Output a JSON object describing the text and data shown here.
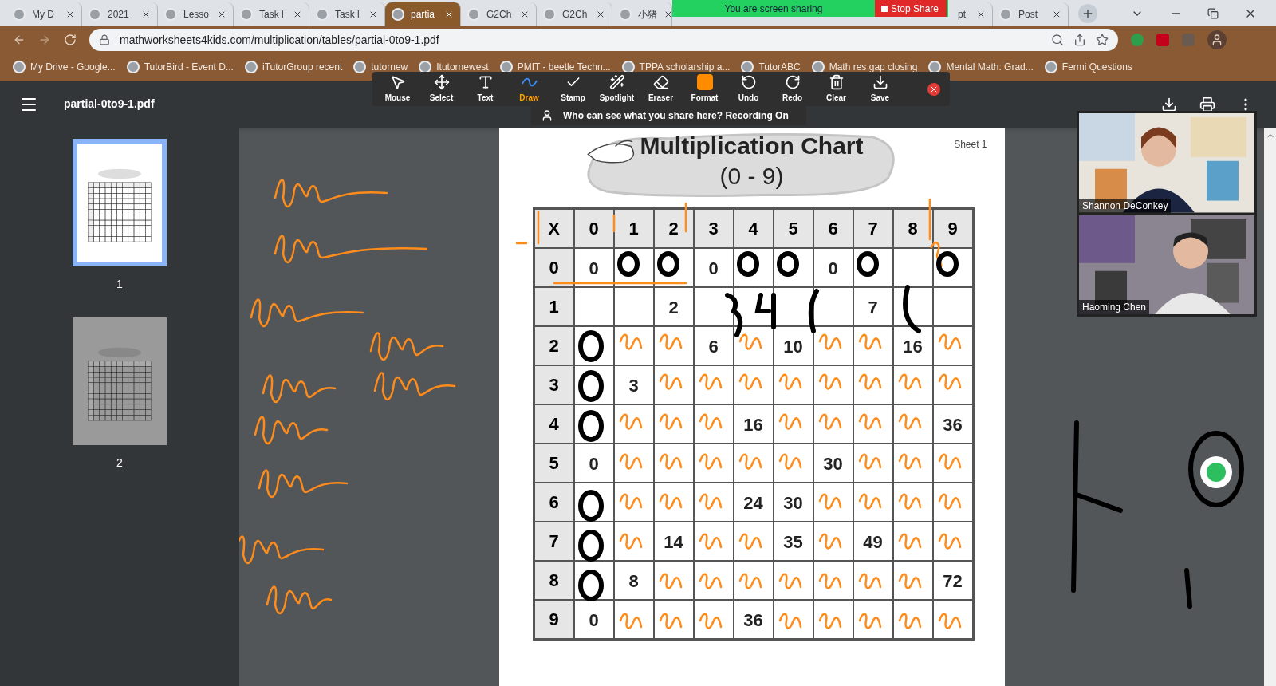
{
  "browser": {
    "tabs": [
      {
        "label": "My D",
        "selected": false
      },
      {
        "label": "2021",
        "selected": false
      },
      {
        "label": "Lesso",
        "selected": false
      },
      {
        "label": "Task l",
        "selected": false
      },
      {
        "label": "Task l",
        "selected": false
      },
      {
        "label": "partia",
        "selected": true
      },
      {
        "label": "G2Ch",
        "selected": false
      },
      {
        "label": "G2Ch",
        "selected": false
      },
      {
        "label": "小猪",
        "selected": false
      },
      {
        "label": "pt",
        "selected": false
      },
      {
        "label": "Post",
        "selected": false
      }
    ],
    "address": "mathworksheets4kids.com/multiplication/tables/partial-0to9-1.pdf",
    "bookmarks": [
      "My Drive - Google...",
      "TutorBird - Event D...",
      "iTutorGroup recent",
      "tutornew",
      "Itutornewest",
      "PMIT - beetle Techn...",
      "TPPA scholarship a...",
      "TutorABC",
      "Math res gap closing",
      "Mental Math: Grad...",
      "Fermi Questions"
    ]
  },
  "share_banner": {
    "status": "You are screen sharing",
    "stop": "Stop Share"
  },
  "pdf": {
    "filename": "partial-0to9-1.pdf",
    "thumbnails": [
      {
        "label": "1",
        "selected": true
      },
      {
        "label": "2",
        "selected": false
      }
    ]
  },
  "annotate_toolbar": {
    "tools": [
      {
        "kind": "mouse",
        "label": "Mouse",
        "selected": false
      },
      {
        "kind": "select",
        "label": "Select",
        "selected": false
      },
      {
        "kind": "text",
        "label": "Text",
        "selected": false
      },
      {
        "kind": "draw",
        "label": "Draw",
        "selected": true
      },
      {
        "kind": "stamp",
        "label": "Stamp",
        "selected": false
      },
      {
        "kind": "spotlight",
        "label": "Spotlight",
        "selected": false
      },
      {
        "kind": "eraser",
        "label": "Eraser",
        "selected": false
      },
      {
        "kind": "format",
        "label": "Format",
        "selected": false
      },
      {
        "kind": "undo",
        "label": "Undo",
        "selected": false
      },
      {
        "kind": "redo",
        "label": "Redo",
        "selected": false
      },
      {
        "kind": "clear",
        "label": "Clear",
        "selected": false
      },
      {
        "kind": "save",
        "label": "Save",
        "selected": false
      }
    ],
    "notice": "Who can see what you share here? Recording On"
  },
  "worksheet": {
    "title": "Multiplication Chart",
    "range": "(0 - 9)",
    "sheet": "Sheet 1",
    "corner": "X",
    "columns": [
      "0",
      "1",
      "2",
      "3",
      "4",
      "5",
      "6",
      "7",
      "8",
      "9"
    ],
    "rows": [
      {
        "header": "0",
        "cells": [
          "0",
          null,
          null,
          "0",
          null,
          null,
          "0",
          null,
          null,
          null
        ]
      },
      {
        "header": "1",
        "cells": [
          null,
          null,
          "2",
          null,
          null,
          null,
          null,
          "7",
          null,
          null
        ]
      },
      {
        "header": "2",
        "cells": [
          null,
          null,
          null,
          "6",
          null,
          "10",
          null,
          null,
          "16",
          null
        ]
      },
      {
        "header": "3",
        "cells": [
          null,
          "3",
          null,
          null,
          null,
          null,
          null,
          null,
          null,
          null
        ]
      },
      {
        "header": "4",
        "cells": [
          null,
          null,
          null,
          null,
          "16",
          null,
          null,
          null,
          null,
          "36"
        ]
      },
      {
        "header": "5",
        "cells": [
          "0",
          null,
          null,
          null,
          null,
          null,
          "30",
          null,
          null,
          null
        ]
      },
      {
        "header": "6",
        "cells": [
          null,
          null,
          null,
          null,
          "24",
          "30",
          null,
          null,
          null,
          null
        ]
      },
      {
        "header": "7",
        "cells": [
          null,
          null,
          "14",
          null,
          null,
          "35",
          null,
          "49",
          null,
          null
        ]
      },
      {
        "header": "8",
        "cells": [
          null,
          "8",
          null,
          null,
          null,
          null,
          null,
          null,
          null,
          "72"
        ]
      },
      {
        "header": "9",
        "cells": [
          "0",
          null,
          null,
          null,
          "36",
          null,
          null,
          null,
          null,
          null
        ]
      }
    ]
  },
  "participants": [
    {
      "name": "Shannon DeConkey"
    },
    {
      "name": "Haoming Chen"
    }
  ]
}
